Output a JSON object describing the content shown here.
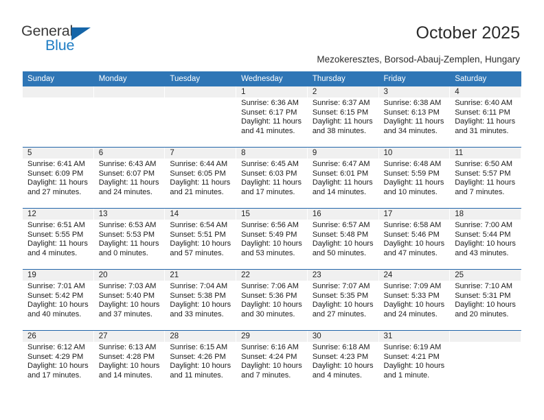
{
  "brand": {
    "name_top": "General",
    "name_bottom": "Blue",
    "top_color": "#3a3a3a",
    "bottom_color": "#1f7dc4",
    "triangle_color": "#1565a8"
  },
  "header": {
    "title": "October 2025",
    "subtitle": "Mezokeresztes, Borsod-Abauj-Zemplen, Hungary",
    "accent_color": "#2f76b6",
    "grid_line_color": "#1f63a8",
    "date_band_color": "#f0f0f0"
  },
  "weekday_headers": [
    "Sunday",
    "Monday",
    "Tuesday",
    "Wednesday",
    "Thursday",
    "Friday",
    "Saturday"
  ],
  "weeks": [
    [
      {
        "date": "",
        "empty": true
      },
      {
        "date": "",
        "empty": true
      },
      {
        "date": "",
        "empty": true
      },
      {
        "date": "1",
        "sunrise": "Sunrise: 6:36 AM",
        "sunset": "Sunset: 6:17 PM",
        "daylight1": "Daylight: 11 hours",
        "daylight2": "and 41 minutes."
      },
      {
        "date": "2",
        "sunrise": "Sunrise: 6:37 AM",
        "sunset": "Sunset: 6:15 PM",
        "daylight1": "Daylight: 11 hours",
        "daylight2": "and 38 minutes."
      },
      {
        "date": "3",
        "sunrise": "Sunrise: 6:38 AM",
        "sunset": "Sunset: 6:13 PM",
        "daylight1": "Daylight: 11 hours",
        "daylight2": "and 34 minutes."
      },
      {
        "date": "4",
        "sunrise": "Sunrise: 6:40 AM",
        "sunset": "Sunset: 6:11 PM",
        "daylight1": "Daylight: 11 hours",
        "daylight2": "and 31 minutes."
      }
    ],
    [
      {
        "date": "5",
        "sunrise": "Sunrise: 6:41 AM",
        "sunset": "Sunset: 6:09 PM",
        "daylight1": "Daylight: 11 hours",
        "daylight2": "and 27 minutes."
      },
      {
        "date": "6",
        "sunrise": "Sunrise: 6:43 AM",
        "sunset": "Sunset: 6:07 PM",
        "daylight1": "Daylight: 11 hours",
        "daylight2": "and 24 minutes."
      },
      {
        "date": "7",
        "sunrise": "Sunrise: 6:44 AM",
        "sunset": "Sunset: 6:05 PM",
        "daylight1": "Daylight: 11 hours",
        "daylight2": "and 21 minutes."
      },
      {
        "date": "8",
        "sunrise": "Sunrise: 6:45 AM",
        "sunset": "Sunset: 6:03 PM",
        "daylight1": "Daylight: 11 hours",
        "daylight2": "and 17 minutes."
      },
      {
        "date": "9",
        "sunrise": "Sunrise: 6:47 AM",
        "sunset": "Sunset: 6:01 PM",
        "daylight1": "Daylight: 11 hours",
        "daylight2": "and 14 minutes."
      },
      {
        "date": "10",
        "sunrise": "Sunrise: 6:48 AM",
        "sunset": "Sunset: 5:59 PM",
        "daylight1": "Daylight: 11 hours",
        "daylight2": "and 10 minutes."
      },
      {
        "date": "11",
        "sunrise": "Sunrise: 6:50 AM",
        "sunset": "Sunset: 5:57 PM",
        "daylight1": "Daylight: 11 hours",
        "daylight2": "and 7 minutes."
      }
    ],
    [
      {
        "date": "12",
        "sunrise": "Sunrise: 6:51 AM",
        "sunset": "Sunset: 5:55 PM",
        "daylight1": "Daylight: 11 hours",
        "daylight2": "and 4 minutes."
      },
      {
        "date": "13",
        "sunrise": "Sunrise: 6:53 AM",
        "sunset": "Sunset: 5:53 PM",
        "daylight1": "Daylight: 11 hours",
        "daylight2": "and 0 minutes."
      },
      {
        "date": "14",
        "sunrise": "Sunrise: 6:54 AM",
        "sunset": "Sunset: 5:51 PM",
        "daylight1": "Daylight: 10 hours",
        "daylight2": "and 57 minutes."
      },
      {
        "date": "15",
        "sunrise": "Sunrise: 6:56 AM",
        "sunset": "Sunset: 5:49 PM",
        "daylight1": "Daylight: 10 hours",
        "daylight2": "and 53 minutes."
      },
      {
        "date": "16",
        "sunrise": "Sunrise: 6:57 AM",
        "sunset": "Sunset: 5:48 PM",
        "daylight1": "Daylight: 10 hours",
        "daylight2": "and 50 minutes."
      },
      {
        "date": "17",
        "sunrise": "Sunrise: 6:58 AM",
        "sunset": "Sunset: 5:46 PM",
        "daylight1": "Daylight: 10 hours",
        "daylight2": "and 47 minutes."
      },
      {
        "date": "18",
        "sunrise": "Sunrise: 7:00 AM",
        "sunset": "Sunset: 5:44 PM",
        "daylight1": "Daylight: 10 hours",
        "daylight2": "and 43 minutes."
      }
    ],
    [
      {
        "date": "19",
        "sunrise": "Sunrise: 7:01 AM",
        "sunset": "Sunset: 5:42 PM",
        "daylight1": "Daylight: 10 hours",
        "daylight2": "and 40 minutes."
      },
      {
        "date": "20",
        "sunrise": "Sunrise: 7:03 AM",
        "sunset": "Sunset: 5:40 PM",
        "daylight1": "Daylight: 10 hours",
        "daylight2": "and 37 minutes."
      },
      {
        "date": "21",
        "sunrise": "Sunrise: 7:04 AM",
        "sunset": "Sunset: 5:38 PM",
        "daylight1": "Daylight: 10 hours",
        "daylight2": "and 33 minutes."
      },
      {
        "date": "22",
        "sunrise": "Sunrise: 7:06 AM",
        "sunset": "Sunset: 5:36 PM",
        "daylight1": "Daylight: 10 hours",
        "daylight2": "and 30 minutes."
      },
      {
        "date": "23",
        "sunrise": "Sunrise: 7:07 AM",
        "sunset": "Sunset: 5:35 PM",
        "daylight1": "Daylight: 10 hours",
        "daylight2": "and 27 minutes."
      },
      {
        "date": "24",
        "sunrise": "Sunrise: 7:09 AM",
        "sunset": "Sunset: 5:33 PM",
        "daylight1": "Daylight: 10 hours",
        "daylight2": "and 24 minutes."
      },
      {
        "date": "25",
        "sunrise": "Sunrise: 7:10 AM",
        "sunset": "Sunset: 5:31 PM",
        "daylight1": "Daylight: 10 hours",
        "daylight2": "and 20 minutes."
      }
    ],
    [
      {
        "date": "26",
        "sunrise": "Sunrise: 6:12 AM",
        "sunset": "Sunset: 4:29 PM",
        "daylight1": "Daylight: 10 hours",
        "daylight2": "and 17 minutes."
      },
      {
        "date": "27",
        "sunrise": "Sunrise: 6:13 AM",
        "sunset": "Sunset: 4:28 PM",
        "daylight1": "Daylight: 10 hours",
        "daylight2": "and 14 minutes."
      },
      {
        "date": "28",
        "sunrise": "Sunrise: 6:15 AM",
        "sunset": "Sunset: 4:26 PM",
        "daylight1": "Daylight: 10 hours",
        "daylight2": "and 11 minutes."
      },
      {
        "date": "29",
        "sunrise": "Sunrise: 6:16 AM",
        "sunset": "Sunset: 4:24 PM",
        "daylight1": "Daylight: 10 hours",
        "daylight2": "and 7 minutes."
      },
      {
        "date": "30",
        "sunrise": "Sunrise: 6:18 AM",
        "sunset": "Sunset: 4:23 PM",
        "daylight1": "Daylight: 10 hours",
        "daylight2": "and 4 minutes."
      },
      {
        "date": "31",
        "sunrise": "Sunrise: 6:19 AM",
        "sunset": "Sunset: 4:21 PM",
        "daylight1": "Daylight: 10 hours",
        "daylight2": "and 1 minute."
      },
      {
        "date": "",
        "empty": true
      }
    ]
  ]
}
